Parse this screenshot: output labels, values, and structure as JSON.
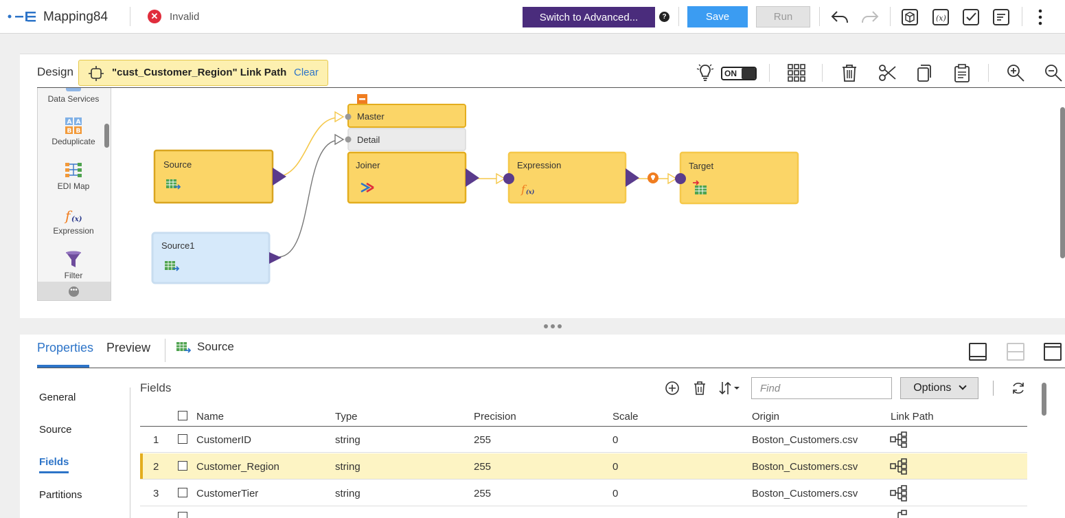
{
  "header": {
    "app_title": "Mapping84",
    "status_text": "Invalid",
    "switch_advanced_label": "Switch to Advanced...",
    "help_glyph": "?",
    "save_label": "Save",
    "run_label": "Run"
  },
  "design": {
    "label": "Design",
    "link_path_text": "\"cust_Customer_Region\" Link Path",
    "clear_label": "Clear",
    "toggle_label": "ON",
    "palette": [
      {
        "label": "Data Services"
      },
      {
        "label": "Deduplicate"
      },
      {
        "label": "EDI Map"
      },
      {
        "label": "Expression"
      },
      {
        "label": "Filter"
      }
    ],
    "nodes": {
      "source": "Source",
      "source1": "Source1",
      "master": "Master",
      "detail": "Detail",
      "joiner": "Joiner",
      "expression": "Expression",
      "target": "Target"
    }
  },
  "properties": {
    "tabs": [
      "Properties",
      "Preview"
    ],
    "selected_object": "Source",
    "side_nav": [
      "General",
      "Source",
      "Fields",
      "Partitions"
    ],
    "fields_title": "Fields",
    "find_placeholder": "Find",
    "options_label": "Options",
    "columns": [
      "Name",
      "Type",
      "Precision",
      "Scale",
      "Origin",
      "Link Path"
    ],
    "rows": [
      {
        "num": "1",
        "name": "CustomerID",
        "type": "string",
        "precision": "255",
        "scale": "0",
        "origin": "Boston_Customers.csv"
      },
      {
        "num": "2",
        "name": "Customer_Region",
        "type": "string",
        "precision": "255",
        "scale": "0",
        "origin": "Boston_Customers.csv"
      },
      {
        "num": "3",
        "name": "CustomerTier",
        "type": "string",
        "precision": "255",
        "scale": "0",
        "origin": "Boston_Customers.csv"
      }
    ]
  },
  "colors": {
    "accent": "#2d74c8",
    "advanced_btn": "#4a2c7c",
    "save_btn": "#3b9cf2",
    "node_fill": "#fbd567",
    "node_border": "#e3ad1e",
    "node_selected_fill": "#d6e9fa",
    "port": "#5a3b8c",
    "link_highlight": "#f5c84a"
  }
}
